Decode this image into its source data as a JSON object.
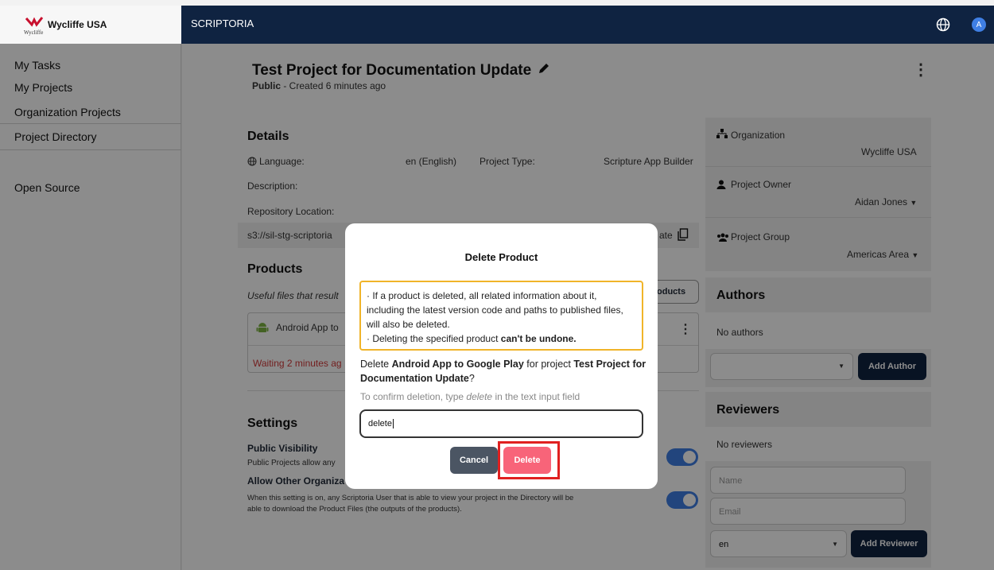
{
  "header": {
    "org_name": "Wycliffe USA",
    "logo_word": "Wycliffe",
    "app_title": "SCRIPTORIA",
    "avatar_initial": "A"
  },
  "sidebar": {
    "items": [
      "My Tasks",
      "My Projects",
      "Organization Projects",
      "Project Directory",
      "Open Source"
    ]
  },
  "project": {
    "title": "Test Project for Documentation Update",
    "visibility": "Public",
    "created": " - Created 6 minutes ago"
  },
  "details": {
    "heading": "Details",
    "language_label": "Language:",
    "language_value": "en (English)",
    "project_type_label": "Project Type:",
    "project_type_value": "Scripture App Builder",
    "description_label": "Description:",
    "repo_label": "Repository Location:",
    "repo_value": "s3://sil-stg-scriptoria",
    "repo_suffix": "ate"
  },
  "products": {
    "heading": "Products",
    "subtitle": "Useful files that result",
    "button_fragment": "oducts",
    "item_name": "Android App to",
    "item_status": "Waiting 2 minutes ag"
  },
  "settings": {
    "heading": "Settings",
    "public_title": "Public Visibility",
    "public_desc": "Public Projects allow any",
    "allow_title": "Allow Other Organiza",
    "allow_desc_1": "When this setting is on, any Scriptoria User that is able to view your project in the Directory will be",
    "allow_desc_2": "able to download the Product Files (the outputs of the products)."
  },
  "right": {
    "org_label": "Organization",
    "org_value": "Wycliffe USA",
    "owner_label": "Project Owner",
    "owner_value": "Aidan Jones",
    "group_label": "Project Group",
    "group_value": "Americas Area",
    "authors_heading": "Authors",
    "no_authors": "No authors",
    "add_author": "Add Author",
    "reviewers_heading": "Reviewers",
    "no_reviewers": "No reviewers",
    "name_placeholder": "Name",
    "email_placeholder": "Email",
    "locale_value": "en",
    "add_reviewer": "Add Reviewer"
  },
  "modal": {
    "title": "Delete Product",
    "warn_1": "If a product is deleted, all related information about it, including the latest version code and paths to published files, will also be deleted.",
    "warn_2_prefix": "Deleting the specified product ",
    "warn_2_bold": "can't be undone.",
    "q_prefix": "Delete ",
    "q_product": "Android App to Google Play",
    "q_mid": " for project ",
    "q_project": "Test Project for Documentation Update",
    "q_end": "?",
    "hint_prefix": "To confirm deletion, type ",
    "hint_word": "delete",
    "hint_suffix": " in the text input field",
    "input_value": "delete",
    "cancel": "Cancel",
    "delete": "Delete"
  },
  "colors": {
    "navy": "#0f2341",
    "accent": "#3f7fe4",
    "danger": "#f86479",
    "warning": "#f0b429",
    "highlight": "#e02020"
  }
}
